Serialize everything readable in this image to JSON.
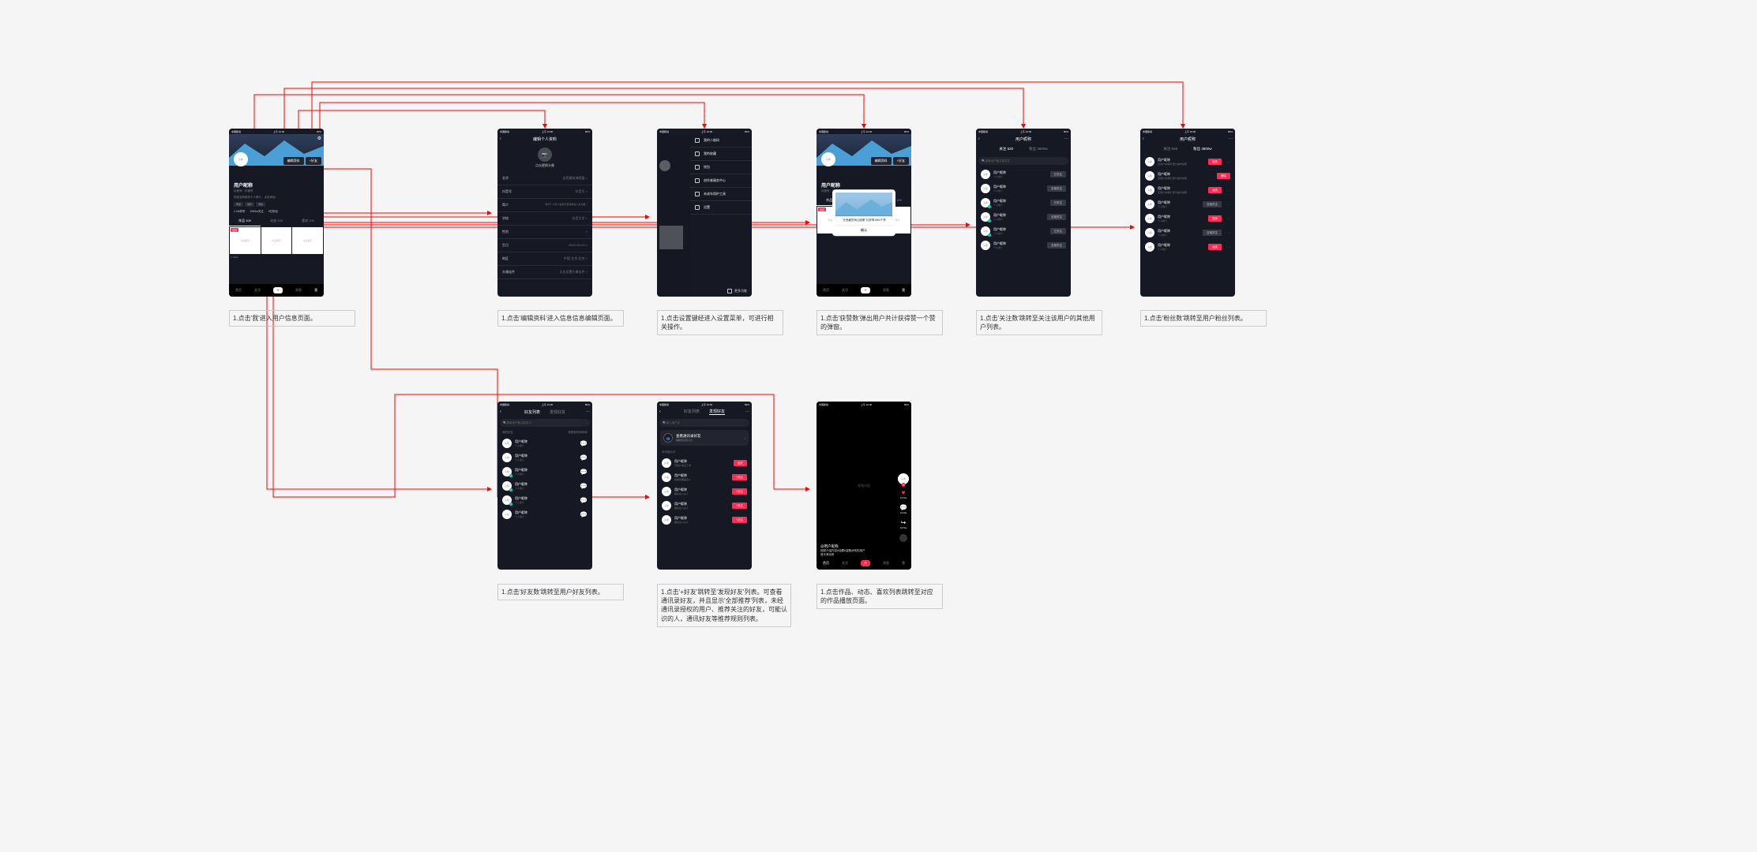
{
  "status": {
    "carrier": "中国移动",
    "time": "上午 10:00",
    "battery": "80%"
  },
  "profile": {
    "avatar_text": "头像",
    "edit_btn": "编辑资料",
    "add_friend_btn": "+好友",
    "nickname": "用户昵称",
    "douyin_id_label": "抖音号：抖音号",
    "bio_prompt": "你还没有填写个人简介，点击添加...",
    "tags": [
      "年龄",
      "城市",
      "学校"
    ],
    "stats": {
      "praise": "1.2w获赞",
      "following": "1000w关注",
      "fans": "2亿粉丝"
    },
    "tabs": {
      "works": "作品 100",
      "dynamic": "动态 100",
      "likes": "喜欢 100"
    },
    "grid_placeholder": "作品展示",
    "view_count": "▷100w",
    "pinned_badge": "置顶"
  },
  "nav": {
    "home": "首页",
    "follow": "关注",
    "plus": "＋",
    "message": "消息",
    "me": "我"
  },
  "edit_profile": {
    "title": "编辑个人资料",
    "change_avatar": "点击更换头像",
    "rows": [
      {
        "label": "名字",
        "value": "去西藏拍海鸥蛋 >"
      },
      {
        "label": "抖音号",
        "value": "抖音号 >"
      },
      {
        "label": "简介",
        "value": "填写个人简介会吸引更多粉丝人关注哦 >"
      },
      {
        "label": "学校",
        "value": "抖音大学 >"
      },
      {
        "label": "性别",
        "value": ">"
      },
      {
        "label": "生日",
        "value": "2000-05-20 >"
      },
      {
        "label": "地区",
        "value": "中国·北京·北京 >"
      },
      {
        "label": "头像挂件",
        "value": "点击设置头像挂件 >"
      }
    ]
  },
  "settings_menu": {
    "items": [
      "我的二维码",
      "我的收藏",
      "钱包",
      "创作者服务中心",
      "未成年保护工具",
      "设置"
    ],
    "more": "更多功能"
  },
  "praise_dialog": {
    "text": "\"去西藏的海云鸥蛋\"共获得1884个赞",
    "confirm": "确认"
  },
  "follow_list": {
    "title": "用户昵称",
    "tab_follow": "关注 520",
    "tab_fans": "粉丝 3800w",
    "search_placeholder": "搜索用户备注或名字",
    "user_name": "用户昵称",
    "user_desc": "个人简介",
    "user_desc_bio": "该用户未填写 部分操作说明",
    "btn_followed": "已关注",
    "btn_mutual": "互相关注",
    "btn_return_follow": "回关",
    "btn_remove": "移除"
  },
  "friends_list": {
    "title": "好友列表",
    "tab_find": "发现好友",
    "search_placeholder": "搜索用户备注或名字",
    "section": "我的好友",
    "sort": "按更新时间排序",
    "chat_icon": "💬"
  },
  "discover_friends": {
    "input_placeholder": "输入用户名",
    "contacts_title": "查看通讯录好友",
    "contacts_sub": "看看有没有认识",
    "section": "你可能认识",
    "descs": [
      "该用户关注了你",
      "和成员都是达人",
      "相似达人@人"
    ],
    "btn_return": "回关",
    "btn_follow": "+关注"
  },
  "feed": {
    "content_center": "视频内容",
    "username": "@用户昵称",
    "desc": "视频介绍内容#话题#话题@别的用户",
    "music": "音乐滚动条",
    "like_count": "12.5w",
    "comment_count": "12.5w",
    "share_count": "12.5w"
  },
  "captions": {
    "c1": "1.点击'我'进入用户信息页面。",
    "c2": "1.点击'编辑资料'进入信息信息编辑页面。",
    "c3": "1.点击设置键经进入设置菜单，可进行相关操作。",
    "c4": "1.点击'获赞数'弹出用户共计获得赞一个赞的弹窗。",
    "c5": "1.点击'关注数'跳转至关注该用户的其他用户列表。",
    "c6": "1.点击'粉丝数'跳转至用户粉丝列表。",
    "c7": "1.点击'好友数'跳转至用户好友列表。",
    "c8": "1.点击'+好友'跳转至'发现好友'列表。可查看通讯录好友，并且显示'全部推荐'列表，未经通讯录授权的用户、推荐关注的好友，可能认识的人，通讯好友等推荐规则列表。",
    "c9": "1.点击作品、动态、喜欢列表跳转至对应的作品播放页面。"
  }
}
